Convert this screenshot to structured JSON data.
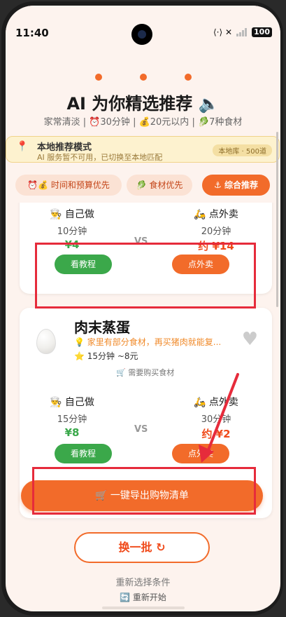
{
  "status_bar": {
    "time": "11:40",
    "right_icons": "⟨·⟩ ✕",
    "battery": "100"
  },
  "header": {
    "title": "AI 为你精选推荐 🔈",
    "subtitle": "家常清淡 | ⏰30分钟 | 💰20元以内 | 🥬7种食材"
  },
  "notice": {
    "title": "本地推荐模式",
    "subtitle": "AI 服务暂不可用，已切换至本地匹配",
    "badge": "本地库 · 500道"
  },
  "tabs": [
    {
      "label": "⏰💰 时间和预算优先"
    },
    {
      "label": "🥬 食材优先"
    },
    {
      "label": "⚓ 综合推荐"
    }
  ],
  "card1": {
    "self": {
      "title": "👨‍🍳 自己做",
      "time": "10分钟",
      "price": "¥4",
      "button": "看教程"
    },
    "vs": "VS",
    "delivery": {
      "title": "🛵 点外卖",
      "time": "20分钟",
      "price": "约 ¥14",
      "button": "点外卖"
    }
  },
  "card2": {
    "name": "肉末蒸蛋",
    "tip": "💡 家里有部分食材，再买猪肉就能复...",
    "meta": "⭐ 15分钟  ~8元",
    "shop": "🛒 需要购买食材",
    "self": {
      "title": "👨‍🍳 自己做",
      "time": "15分钟",
      "price": "¥8",
      "button": "看教程"
    },
    "vs": "VS",
    "delivery": {
      "title": "🛵 点外卖",
      "time": "30分钟",
      "price": "约 ¥2",
      "button": "点外卖"
    }
  },
  "export_button": "🛒  一键导出购物清单",
  "more_button": "换一批 ↻",
  "reselect": "重新选择条件",
  "restart": "🔄 重新开始",
  "colors": {
    "accent": "#f26b2a",
    "green": "#3ba84a",
    "annotation": "#e62b3b"
  }
}
